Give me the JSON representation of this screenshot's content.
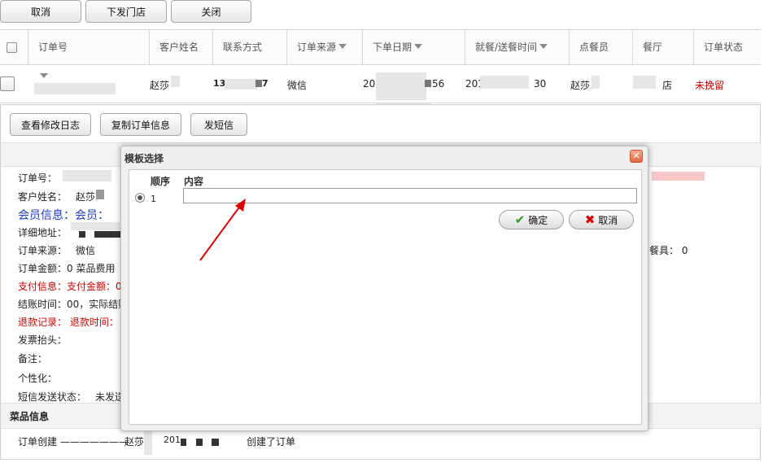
{
  "toolbar": {
    "cancel_label": "取消",
    "dispatch_label": "下发门店",
    "close_label": "关闭"
  },
  "grid": {
    "headers": {
      "order_no": "订单号",
      "customer_name": "客户姓名",
      "contact": "联系方式",
      "source": "订单来源",
      "order_date": "下单日期",
      "meal_time": "就餐/送餐时间",
      "server": "点餐员",
      "restaurant": "餐厅",
      "status": "订单状态"
    },
    "row": {
      "customer": "赵莎",
      "phone_prefix": "13",
      "phone_suffix": "7",
      "source": "微信",
      "order_date_prefix": "201",
      "order_date_suffix": "56",
      "meal_prefix": "201",
      "meal_suffix": "30",
      "server": "赵莎",
      "restaurant_suffix": "店",
      "status": "未挽留"
    }
  },
  "detail": {
    "buttons": {
      "view_log": "查看修改日志",
      "copy_order": "复制订单信息",
      "send_sms": "发短信"
    },
    "fields": {
      "order_no": "订单号：",
      "customer_label": "客户姓名：",
      "customer_value": "赵莎",
      "member_info": "会员信息：会员：",
      "address": "详细地址：",
      "source_label": "订单来源：",
      "source_value": "微信",
      "amount": "订单金额：0    菜品费用",
      "pay_info": "支付信息：支付金额：0",
      "settle": "结账时间：00，实际结账",
      "refund": "退款记录：  退款时间：",
      "invoice": "发票抬头：",
      "remark": "备注：",
      "personal": "个性化：",
      "sms_status_label": "短信发送状态：",
      "sms_status_value": "未发送",
      "utensil": "餐具：  0"
    },
    "dish_section": "菜品信息",
    "log": {
      "event": "订单创建 ———————",
      "user": "赵莎",
      "date_prefix": "201",
      "action": "创建了订单"
    }
  },
  "modal": {
    "title": "模板选择",
    "close_glyph": "✕",
    "col_order": "顺序",
    "col_content": "内容",
    "row_index": "1",
    "content_value": "",
    "confirm_label": "确定",
    "cancel_label": "取消",
    "confirm_icon": "checkmark-icon",
    "cancel_icon": "x-icon"
  },
  "colors": {
    "status_red": "#d40000",
    "member_blue": "#1a3bcc",
    "annotation_arrow": "#e00000"
  }
}
